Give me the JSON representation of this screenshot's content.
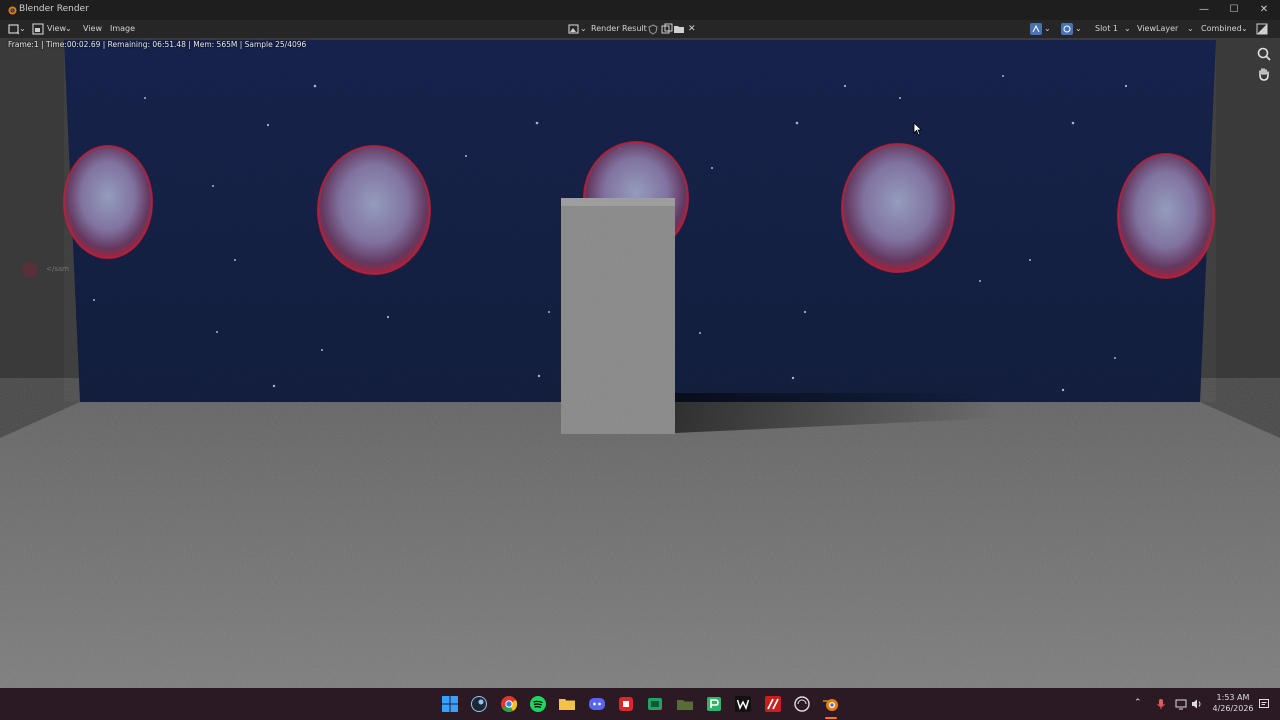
{
  "window": {
    "title": "Blender Render",
    "icon": "blender-icon",
    "controls": [
      "minimize-icon",
      "maximize-icon",
      "close-icon"
    ]
  },
  "header": {
    "editor_type_icon": "image-editor-icon",
    "menus": [
      "View",
      "View",
      "Image"
    ],
    "image_name": "Render Result",
    "slot": "Slot 1",
    "view_layer": "ViewLayer",
    "pass": "Combined"
  },
  "status": {
    "text": "Frame:1 | Time:00:02.69 | Remaining: 06:51.48 | Mem: 565M | Sample 25/4096"
  },
  "render_overlay_text": "</sam",
  "taskbar": {
    "apps": [
      "windows-start-icon",
      "steam-icon",
      "chrome-icon",
      "spotify-icon",
      "file-explorer-icon",
      "discord-icon",
      "app-red-icon",
      "app-green-icon",
      "app-folder-icon",
      "app-green2-icon",
      "app-w-icon",
      "app-slash-icon",
      "app-circle-icon",
      "blender-icon"
    ],
    "time": "1:53 AM",
    "date": "4/26/2026"
  },
  "colors": {
    "accent_blue": "#4772b3",
    "blender_orange": "#e87d0d",
    "wall_blue": "#0c1a42",
    "floor_gray": "#6e6e6e"
  }
}
